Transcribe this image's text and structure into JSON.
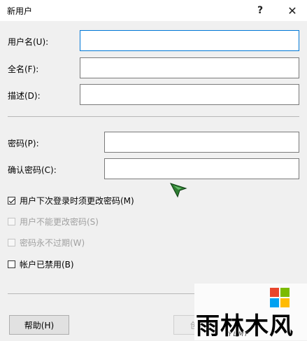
{
  "window": {
    "title": "新用户",
    "help_glyph": "?",
    "close_glyph": "✕"
  },
  "form": {
    "username_label": "用户名(U):",
    "username_value": "",
    "fullname_label": "全名(F):",
    "fullname_value": "",
    "description_label": "描述(D):",
    "description_value": "",
    "password_label": "密码(P):",
    "password_value": "",
    "confirm_label": "确认密码(C):",
    "confirm_value": ""
  },
  "options": [
    {
      "label": "用户下次登录时须更改密码(M)",
      "checked": true,
      "enabled": true
    },
    {
      "label": "用户不能更改密码(S)",
      "checked": false,
      "enabled": false
    },
    {
      "label": "密码永不过期(W)",
      "checked": false,
      "enabled": false
    },
    {
      "label": "帐户已禁用(B)",
      "checked": false,
      "enabled": true
    }
  ],
  "buttons": {
    "help_label": "帮助(H)",
    "create_label": "创"
  },
  "watermark": {
    "text": "雨林木风",
    "sub": "YLMF",
    "colors": [
      "#e8452c",
      "#7cbb00",
      "#00a1f1",
      "#ffbb00"
    ]
  },
  "colors": {
    "focus_border": "#0078d7",
    "cursor": "#2e7d32"
  }
}
